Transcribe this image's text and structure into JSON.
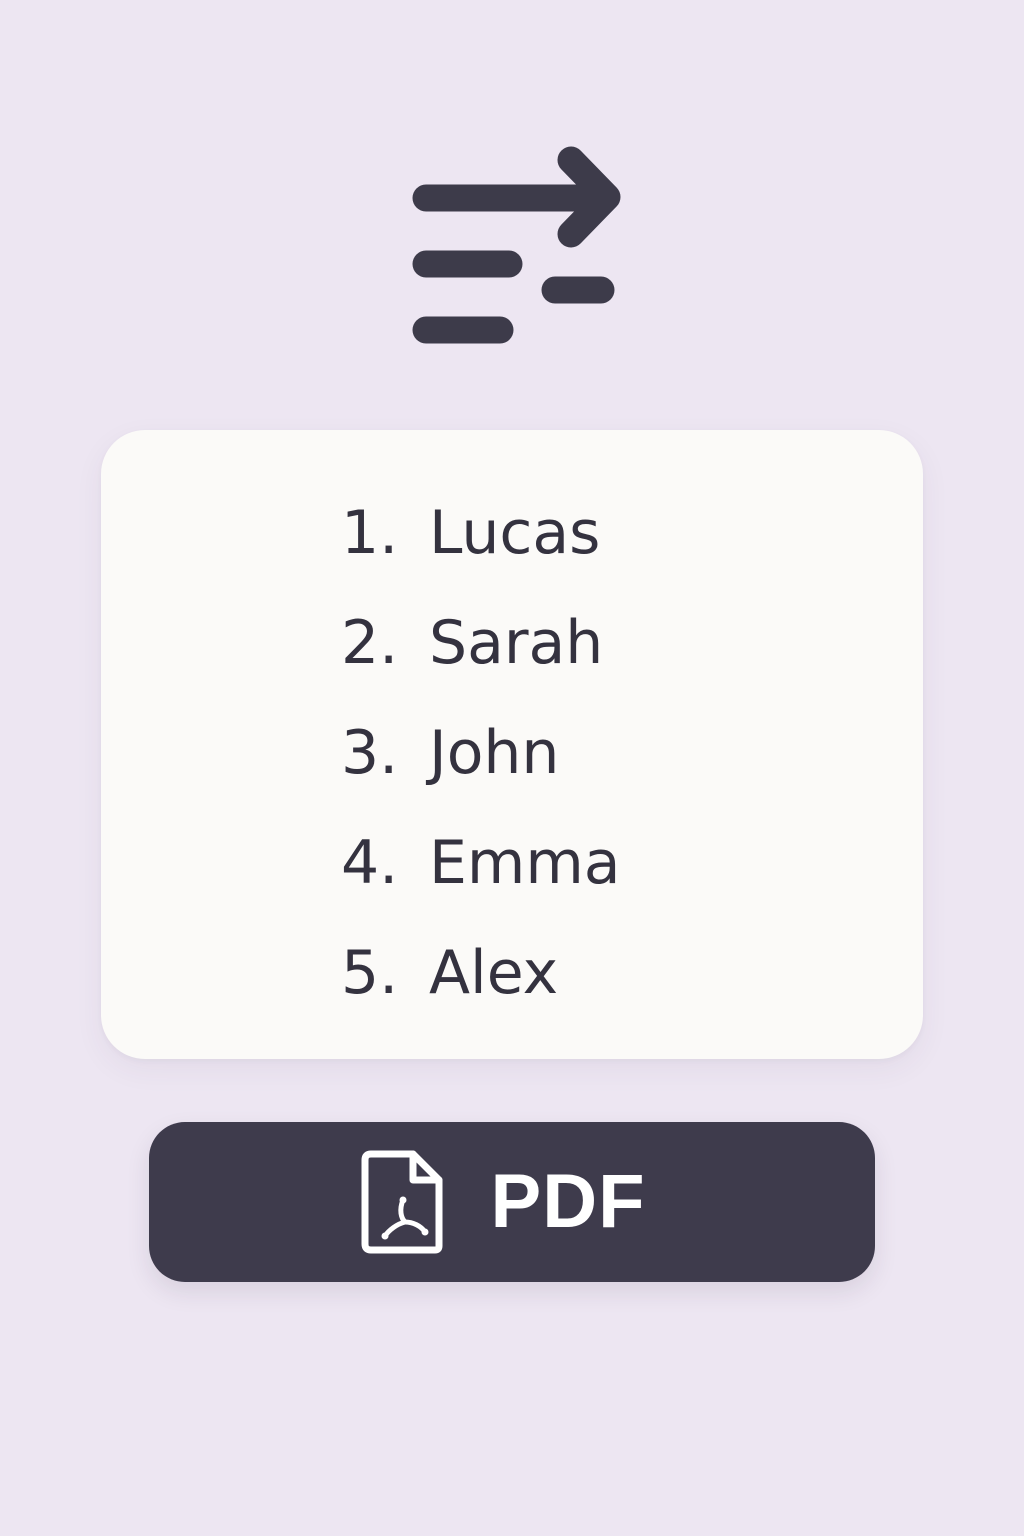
{
  "header": {
    "icon": "text-wrap-arrow-icon"
  },
  "list": {
    "items": [
      {
        "number": "1.",
        "name": "Lucas"
      },
      {
        "number": "2.",
        "name": "Sarah"
      },
      {
        "number": "3.",
        "name": "John"
      },
      {
        "number": "4.",
        "name": "Emma"
      },
      {
        "number": "5.",
        "name": "Alex"
      }
    ]
  },
  "export": {
    "label": "PDF",
    "icon": "pdf-file-icon"
  },
  "colors": {
    "background": "#ede6f2",
    "card": "#fbfaf8",
    "text": "#34323f",
    "button": "#3e3b4c",
    "button_text": "#ffffff"
  }
}
